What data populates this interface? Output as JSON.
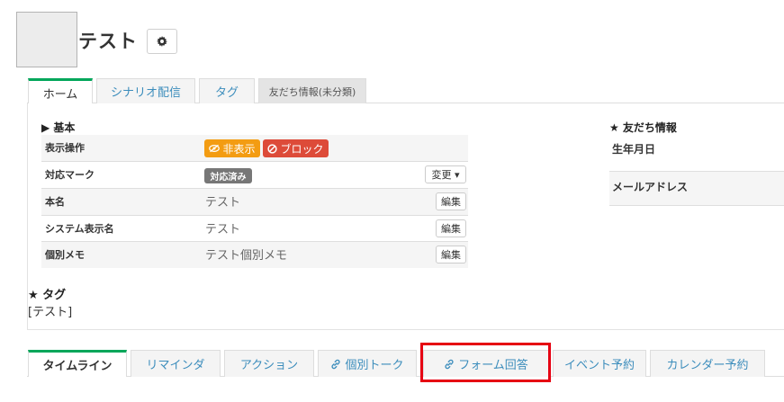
{
  "profile": {
    "name": "テスト"
  },
  "top_tabs": [
    {
      "label": "ホーム"
    },
    {
      "label": "シナリオ配信"
    },
    {
      "label": "タグ"
    },
    {
      "label": "友だち情報(未分類)"
    }
  ],
  "basic": {
    "title": "▶ 基本",
    "rows": [
      {
        "label": "表示操作"
      },
      {
        "label": "対応マーク",
        "badge": "対応済み",
        "button": "変更 ▾"
      },
      {
        "label": "本名",
        "value": "テスト",
        "button": "編集"
      },
      {
        "label": "システム表示名",
        "value": "テスト",
        "button": "編集"
      },
      {
        "label": "個別メモ",
        "value": "テスト個別メモ",
        "button": "編集"
      }
    ],
    "hide_label": "非表示",
    "block_label": "ブロック"
  },
  "friend_info": {
    "title": "★ 友だち情報",
    "fields": [
      {
        "label": "生年月日"
      },
      {
        "label": "メールアドレス"
      }
    ]
  },
  "tags": {
    "title": "★ タグ",
    "value": "[テスト]"
  },
  "bottom_tabs": [
    {
      "label": "タイムライン"
    },
    {
      "label": "リマインダ"
    },
    {
      "label": "アクション"
    },
    {
      "label": "個別トーク"
    },
    {
      "label": "フォーム回答"
    },
    {
      "label": "イベント予約"
    },
    {
      "label": "カレンダー予約"
    }
  ],
  "colors": {
    "active_tab_border": "#00a65a",
    "link": "#3c8dbc",
    "orange_badge": "#f39c12",
    "red_badge": "#dd4b39",
    "highlight": "#e60012"
  }
}
